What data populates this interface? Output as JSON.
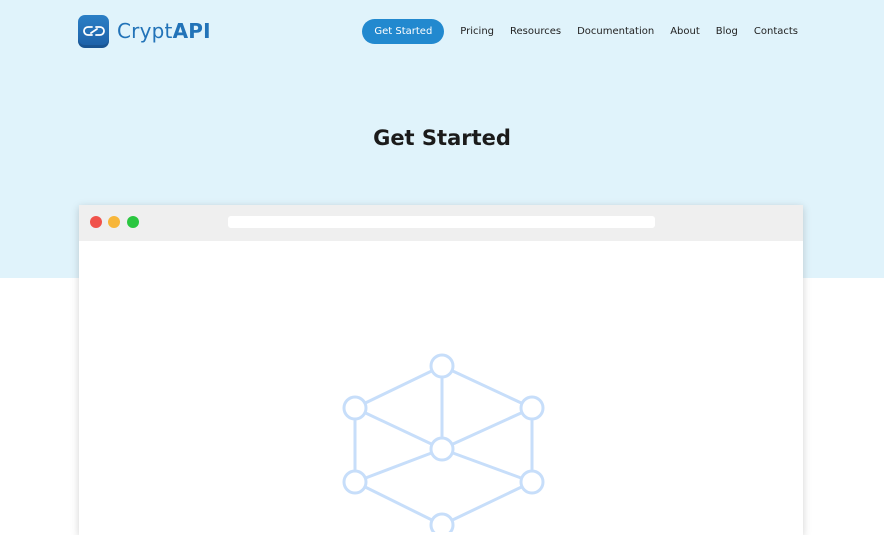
{
  "brand": {
    "name_prefix": "Crypt",
    "name_suffix": "API",
    "logo_icon": "chain-link-icon",
    "colors": {
      "brand": "#2273b8",
      "accent": "#2289cf",
      "hero_bg": "#e0f3fb"
    }
  },
  "nav": {
    "cta_label": "Get Started",
    "links": [
      "Pricing",
      "Resources",
      "Documentation",
      "About",
      "Blog",
      "Contacts"
    ]
  },
  "hero": {
    "title": "Get Started"
  },
  "illustration": {
    "icon": "network-cube-icon"
  }
}
